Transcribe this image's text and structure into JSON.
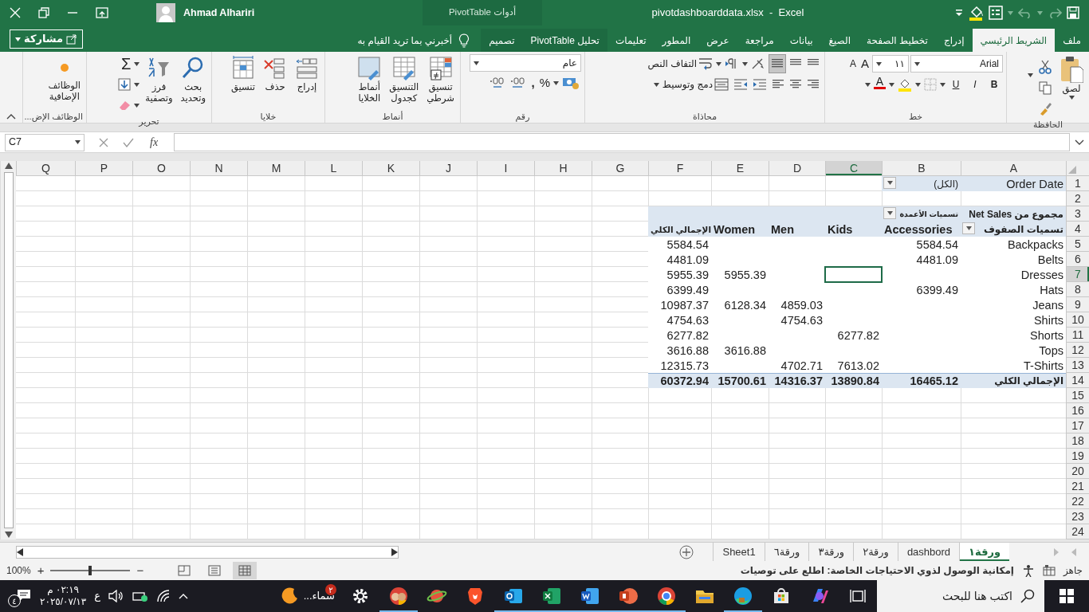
{
  "title_bar": {
    "title": "pivotdashboarddata.xlsx  -  Excel",
    "user": "Ahmad Alhariri",
    "context_group": "أدوات PivotTable"
  },
  "tabs": [
    {
      "label": "ملف",
      "selected": false,
      "kind": "main"
    },
    {
      "label": "الشريط الرئيسي",
      "selected": true,
      "kind": "main"
    },
    {
      "label": "إدراج",
      "selected": false,
      "kind": "main"
    },
    {
      "label": "تخطيط الصفحة",
      "selected": false,
      "kind": "main"
    },
    {
      "label": "الصيغ",
      "selected": false,
      "kind": "main"
    },
    {
      "label": "بيانات",
      "selected": false,
      "kind": "main"
    },
    {
      "label": "مراجعة",
      "selected": false,
      "kind": "main"
    },
    {
      "label": "عرض",
      "selected": false,
      "kind": "main"
    },
    {
      "label": "المطور",
      "selected": false,
      "kind": "main"
    },
    {
      "label": "تعليمات",
      "selected": false,
      "kind": "main"
    },
    {
      "label": "تحليل PivotTable",
      "selected": false,
      "kind": "context"
    },
    {
      "label": "تصميم",
      "selected": false,
      "kind": "context"
    }
  ],
  "tell_me": "أخبرني بما تريد القيام به",
  "share_button": "مشاركة",
  "ribbon": {
    "clipboard": {
      "label": "الحافظة",
      "paste": "لصق"
    },
    "font": {
      "label": "خط",
      "font_name": "Arial",
      "font_size": "١١",
      "grow": "A",
      "shrink": "A",
      "bold": "B",
      "italic": "I",
      "underline": "U",
      "font_color": "A"
    },
    "alignment": {
      "label": "محاذاة",
      "wrap_text": "التفاف النص",
      "merge_center": "دمج وتوسيط"
    },
    "number": {
      "label": "رقم",
      "format": "عام",
      "percent": "%",
      "comma": ","
    },
    "styles": {
      "label": "أنماط",
      "conditional": "تنسيق\nشرطي",
      "as_table": "التنسيق\nكجدول",
      "cell_styles": "أنماط\nالخلايا"
    },
    "cells": {
      "label": "خلايا",
      "insert": "إدراج",
      "delete": "حذف",
      "format": "تنسيق"
    },
    "editing": {
      "label": "تحرير",
      "autosum": "Σ",
      "sort_filter": "فرز\nوتصفية",
      "find_select": "بحث\nوتحديد"
    },
    "addins": {
      "label": "الوظائف الإض...",
      "addins": "الوظائف\nالإضافية"
    }
  },
  "formula_bar": {
    "name_box": "C7",
    "fx": "fx"
  },
  "sheet": {
    "columns": [
      {
        "label": "A",
        "selected": false
      },
      {
        "label": "B",
        "selected": false
      },
      {
        "label": "C",
        "selected": true
      },
      {
        "label": "D",
        "selected": false
      },
      {
        "label": "E",
        "selected": false
      },
      {
        "label": "F",
        "selected": false
      },
      {
        "label": "G",
        "selected": false
      },
      {
        "label": "H",
        "selected": false
      },
      {
        "label": "I",
        "selected": false
      },
      {
        "label": "J",
        "selected": false
      },
      {
        "label": "K",
        "selected": false
      },
      {
        "label": "L",
        "selected": false
      },
      {
        "label": "M",
        "selected": false
      },
      {
        "label": "N",
        "selected": false
      },
      {
        "label": "O",
        "selected": false
      },
      {
        "label": "P",
        "selected": false
      },
      {
        "label": "Q",
        "selected": false
      }
    ],
    "rows": [
      {
        "label": "1",
        "selected": false
      },
      {
        "label": "2",
        "selected": false
      },
      {
        "label": "3",
        "selected": false
      },
      {
        "label": "4",
        "selected": false
      },
      {
        "label": "5",
        "selected": false
      },
      {
        "label": "6",
        "selected": false
      },
      {
        "label": "7",
        "selected": true
      },
      {
        "label": "8",
        "selected": false
      },
      {
        "label": "9",
        "selected": false
      },
      {
        "label": "10",
        "selected": false
      },
      {
        "label": "11",
        "selected": false
      },
      {
        "label": "12",
        "selected": false
      },
      {
        "label": "13",
        "selected": false
      },
      {
        "label": "14",
        "selected": false
      },
      {
        "label": "15",
        "selected": false
      },
      {
        "label": "16",
        "selected": false
      },
      {
        "label": "17",
        "selected": false
      },
      {
        "label": "18",
        "selected": false
      },
      {
        "label": "19",
        "selected": false
      },
      {
        "label": "20",
        "selected": false
      },
      {
        "label": "21",
        "selected": false
      },
      {
        "label": "22",
        "selected": false
      },
      {
        "label": "23",
        "selected": false
      },
      {
        "label": "24",
        "selected": false
      }
    ]
  },
  "pivot": {
    "filter": {
      "field": "Order Date",
      "value": "(الكل)"
    },
    "values_caption": "مجموع من Net Sales",
    "column_labels_caption": "تسميات الأعمدة",
    "row_labels_caption": "تسميات الصفوف",
    "columns": [
      "Accessories",
      "Kids",
      "Men",
      "Women",
      "الإجمالي الكلي"
    ],
    "rows": [
      {
        "label": "Backpacks",
        "values": [
          {
            "kind": "accessories",
            "value": "5584.54"
          },
          {
            "kind": "total",
            "value": "5584.54"
          }
        ]
      },
      {
        "label": "Belts",
        "values": [
          {
            "kind": "accessories",
            "value": "4481.09"
          },
          {
            "kind": "total",
            "value": "4481.09"
          }
        ]
      },
      {
        "label": "Dresses",
        "values": [
          {
            "kind": "women",
            "value": "5955.39"
          },
          {
            "kind": "total",
            "value": "5955.39"
          }
        ]
      },
      {
        "label": "Hats",
        "values": [
          {
            "kind": "accessories",
            "value": "6399.49"
          },
          {
            "kind": "total",
            "value": "6399.49"
          }
        ]
      },
      {
        "label": "Jeans",
        "values": [
          {
            "kind": "men",
            "value": "4859.03"
          },
          {
            "kind": "women",
            "value": "6128.34"
          },
          {
            "kind": "total",
            "value": "10987.37"
          }
        ]
      },
      {
        "label": "Shirts",
        "values": [
          {
            "kind": "men",
            "value": "4754.63"
          },
          {
            "kind": "total",
            "value": "4754.63"
          }
        ]
      },
      {
        "label": "Shorts",
        "values": [
          {
            "kind": "kids",
            "value": "6277.82"
          },
          {
            "kind": "total",
            "value": "6277.82"
          }
        ]
      },
      {
        "label": "Tops",
        "values": [
          {
            "kind": "women",
            "value": "3616.88"
          },
          {
            "kind": "total",
            "value": "3616.88"
          }
        ]
      },
      {
        "label": "T-Shirts",
        "values": [
          {
            "kind": "kids",
            "value": "7613.02"
          },
          {
            "kind": "men",
            "value": "4702.71"
          },
          {
            "kind": "total",
            "value": "12315.73"
          }
        ]
      }
    ],
    "grand_total": {
      "label": "الإجمالي الكلي",
      "values": [
        {
          "kind": "accessories",
          "value": "16465.12"
        },
        {
          "kind": "kids",
          "value": "13890.84"
        },
        {
          "kind": "men",
          "value": "14316.37"
        },
        {
          "kind": "women",
          "value": "15700.61"
        },
        {
          "kind": "total",
          "value": "60372.94"
        }
      ]
    }
  },
  "sheet_tabs": [
    {
      "label": "ورقة١",
      "selected": true
    },
    {
      "label": "dashbord",
      "selected": false
    },
    {
      "label": "ورقة٢",
      "selected": false
    },
    {
      "label": "ورقة٣",
      "selected": false
    },
    {
      "label": "ورقة٦",
      "selected": false
    },
    {
      "label": "Sheet1",
      "selected": false
    }
  ],
  "status_bar": {
    "mode": "جاهز",
    "accessibility": "إمكانية الوصول لذوي الاحتياجات الخاصة: اطلع على توصيات",
    "zoom": "100%",
    "zoom_in": "+",
    "zoom_out": "−",
    "zoom_slider": {
      "level": 0.5
    },
    "views": [
      {
        "kind": "normal",
        "selected": true
      },
      {
        "kind": "page_layout",
        "selected": false
      },
      {
        "kind": "page_break",
        "selected": false
      }
    ]
  },
  "taskbar": {
    "search_placeholder": "اكتب هنا للبحث",
    "weather": "سماء...",
    "weather_badge": "٢",
    "language": "ع",
    "time": "٠٢:١٩ م",
    "date": "٢٠٢٥/٠٧/١٣",
    "notifications": "٤"
  }
}
